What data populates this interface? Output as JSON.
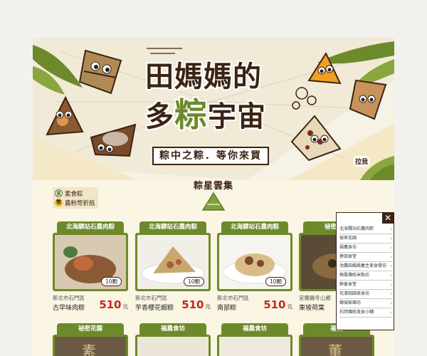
{
  "hero": {
    "title_line1": "田媽媽的",
    "title_line2_a": "多",
    "title_line2_highlight": "粽",
    "title_line2_b": "宇宙",
    "slogan": "粽中之粽．等你來買",
    "side_tab_label": "拉我"
  },
  "section": {
    "title": "粽星雲集"
  },
  "legend": {
    "items": [
      {
        "icon": "素",
        "label": "素食粽"
      },
      {
        "icon": "幣",
        "label": "農粉幣折抵"
      }
    ]
  },
  "products": [
    {
      "shop": "北海驛站石農肉粽",
      "region": "新北市石門區",
      "name": "古早味肉粽",
      "price": "510",
      "unit": "元",
      "pieces": "10顆"
    },
    {
      "shop": "北海驛站石農肉粽",
      "region": "新北市石門區",
      "name": "芋香櫻花蝦粽",
      "price": "510",
      "unit": "元",
      "pieces": "10顆"
    },
    {
      "shop": "北海驛站石農肉粽",
      "region": "新北市石門區",
      "name": "南部粽",
      "price": "510",
      "unit": "元",
      "pieces": "10顆"
    },
    {
      "shop": "祕密花園",
      "region": "宜蘭縣冬山鄉",
      "name": "東坡荷葉",
      "price": "",
      "unit": "",
      "pieces": ""
    }
  ],
  "products_row2": [
    {
      "shop": "祕密花園",
      "photo_text": "素"
    },
    {
      "shop": "福農食坊",
      "photo_text": ""
    },
    {
      "shop": "福農食坊",
      "photo_text": ""
    },
    {
      "shop": "福農",
      "photo_text": "董"
    }
  ],
  "popup": {
    "close": "✕",
    "items": [
      "北海驛站石農肉粽",
      "祕密花園",
      "福農食坊",
      "夢田食堂",
      "池農田媽媽養生美食餐坊",
      "梅鳳傳統米點坊",
      "鮮香食堂",
      "花漾田園美食坊",
      "鄉城家鄉坊",
      "石岡傳統美食小舖"
    ]
  },
  "colors": {
    "accent": "#6d8a2b",
    "brown": "#3b2414",
    "price": "#c5281c"
  }
}
